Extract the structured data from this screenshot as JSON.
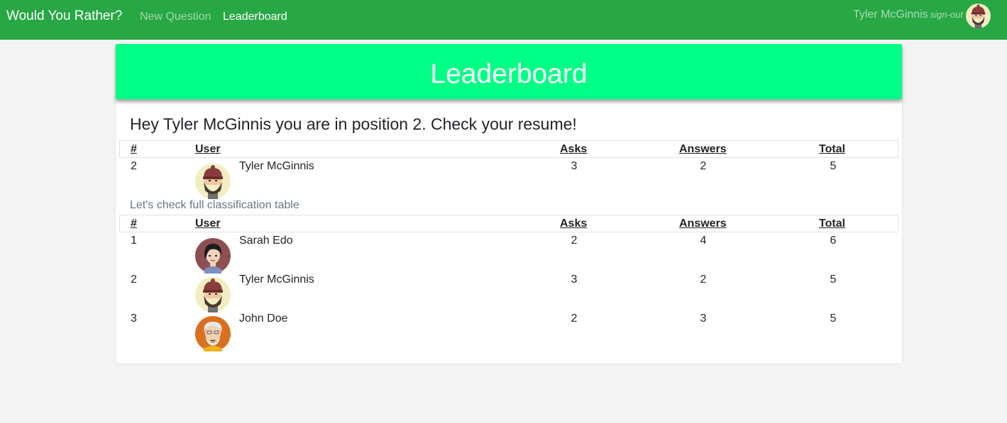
{
  "nav": {
    "brand": "Would You Rather?",
    "links": [
      {
        "label": "New Question",
        "active": false
      },
      {
        "label": "Leaderboard",
        "active": true
      }
    ],
    "user_name": "Tyler McGinnis",
    "signout_label": "sign-out",
    "avatar": "tyler-avatar-icon"
  },
  "colors": {
    "navbar": "#28a745",
    "banner": "#00ff85",
    "page_background": "#f2f3f2"
  },
  "banner": {
    "title": "Leaderboard"
  },
  "greeting": "Hey Tyler McGinnis you are in position 2. Check your resume!",
  "columns": [
    "#",
    "User",
    "Asks",
    "Answers",
    "Total"
  ],
  "current_user_row": {
    "rank": "2",
    "name": "Tyler McGinnis",
    "asks": "3",
    "answers": "2",
    "total": "5",
    "avatar": "tyler-avatar-icon"
  },
  "full_table_caption": "Let's check full classification table",
  "rows": [
    {
      "rank": "1",
      "name": "Sarah Edo",
      "asks": "2",
      "answers": "4",
      "total": "6",
      "avatar": "sarah-avatar-icon"
    },
    {
      "rank": "2",
      "name": "Tyler McGinnis",
      "asks": "3",
      "answers": "2",
      "total": "5",
      "avatar": "tyler-avatar-icon"
    },
    {
      "rank": "3",
      "name": "John Doe",
      "asks": "2",
      "answers": "3",
      "total": "5",
      "avatar": "john-avatar-icon"
    }
  ]
}
